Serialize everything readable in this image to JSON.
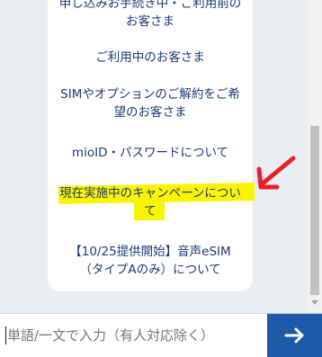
{
  "menu": {
    "options": [
      {
        "lines": [
          "申し込みお手続き中・ご利用前の",
          "お客さま"
        ]
      },
      {
        "lines": [
          "ご利用中のお客さま"
        ]
      },
      {
        "lines": [
          "SIMやオプションのご解約をご希",
          "望のお客さま"
        ]
      },
      {
        "lines": [
          "mioID・パスワードについて"
        ]
      },
      {
        "lines": [
          "現在実施中のキャンペーンについ",
          "て"
        ]
      },
      {
        "lines": [
          "【10/25提供開始】音声eSIM",
          "（タイプAのみ）について"
        ]
      }
    ]
  },
  "annotation": {
    "highlight_color": "#f9f500",
    "arrow_color": "#e8202a"
  },
  "composer": {
    "placeholder": "単語/一文で入力（有人対応除く）",
    "send_icon": "send-arrow-icon",
    "send_color": "#1e5aa8"
  }
}
